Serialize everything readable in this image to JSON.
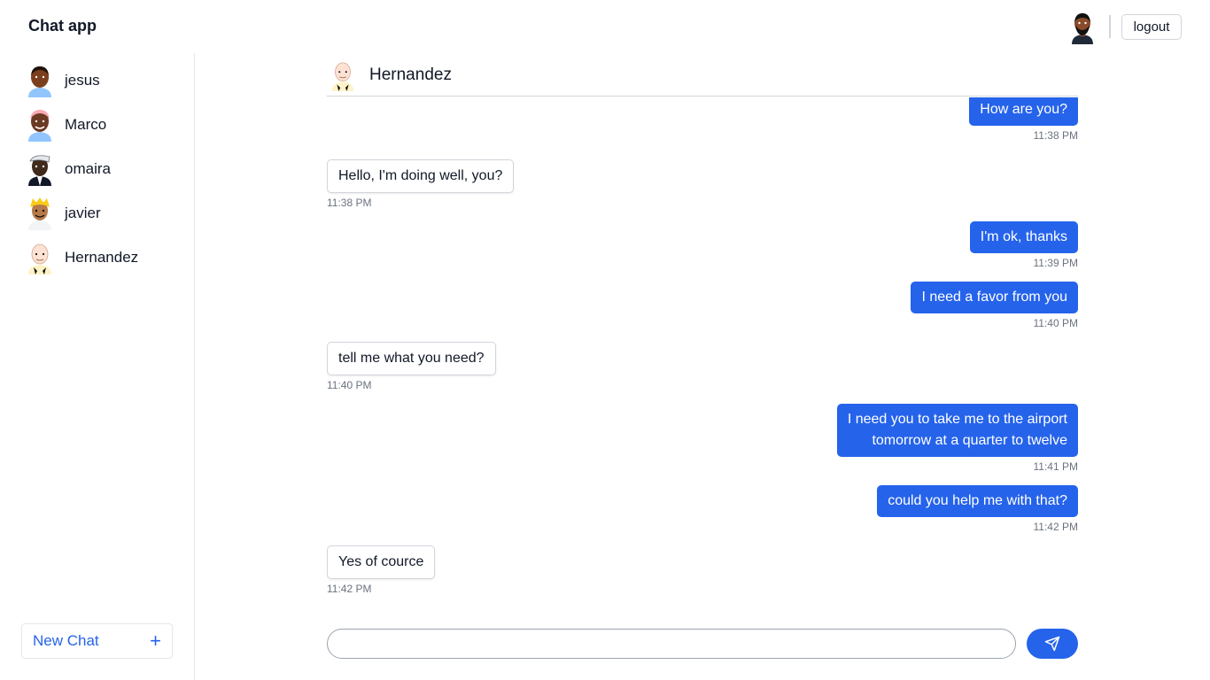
{
  "app": {
    "title": "Chat app"
  },
  "header": {
    "logout_label": "logout",
    "avatar_icon": "user-avatar-bearded"
  },
  "sidebar": {
    "contacts": [
      {
        "name": "jesus",
        "avatar_color": "#7c3f1d"
      },
      {
        "name": "Marco",
        "avatar_color": "#f9a8b4"
      },
      {
        "name": "omaira",
        "avatar_color": "#3f2a1c"
      },
      {
        "name": "javier",
        "avatar_color": "#facc15"
      },
      {
        "name": "Hernandez",
        "avatar_color": "#fde2d4"
      }
    ],
    "new_chat_label": "New Chat",
    "new_chat_icon": "+"
  },
  "chat": {
    "contact_name": "Hernandez",
    "messages": [
      {
        "from": "me",
        "text": "How are you?",
        "time": "11:38 PM"
      },
      {
        "from": "them",
        "text": "Hello, I'm doing well, you?",
        "time": "11:38 PM"
      },
      {
        "from": "me",
        "text": "I'm ok, thanks",
        "time": "11:39 PM"
      },
      {
        "from": "me",
        "text": "I need a favor from you",
        "time": "11:40 PM"
      },
      {
        "from": "them",
        "text": "tell me what you need?",
        "time": "11:40 PM"
      },
      {
        "from": "me",
        "text": "I need you to take me to the airport\ntomorrow at a quarter to twelve",
        "time": "11:41 PM"
      },
      {
        "from": "me",
        "text": "could you help me with that?",
        "time": "11:42 PM"
      },
      {
        "from": "them",
        "text": "Yes of cource",
        "time": "11:42 PM"
      }
    ]
  },
  "composer": {
    "value": "",
    "placeholder": "",
    "send_icon": "paper-plane-icon"
  },
  "colors": {
    "accent": "#2563eb",
    "border": "#d1d5db",
    "muted": "#6b7280"
  }
}
